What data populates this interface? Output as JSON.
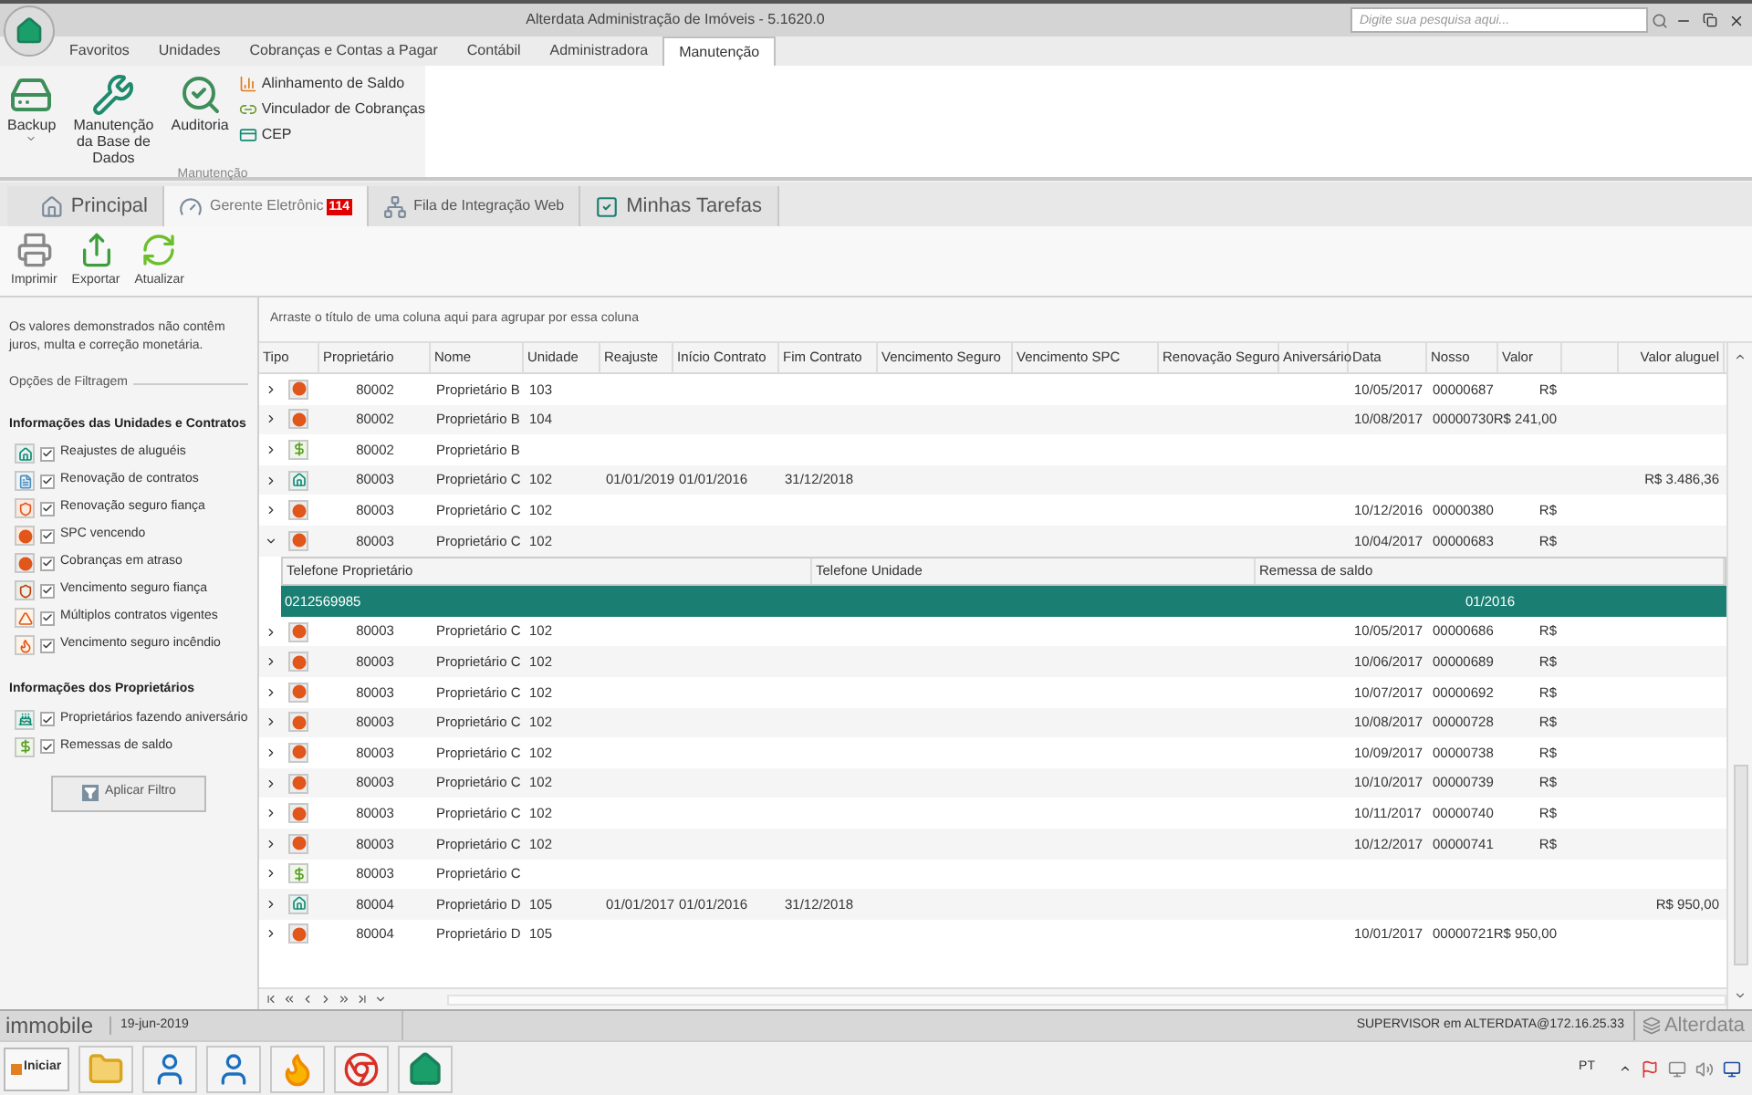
{
  "window": {
    "title": "Alterdata Administração de Imóveis - 5.1620.0",
    "search": {
      "placeholder": "Digite sua pesquisa aqui..."
    }
  },
  "ribbon": {
    "tabs": [
      {
        "label": "Favoritos",
        "selected": false
      },
      {
        "label": "Unidades",
        "selected": false
      },
      {
        "label": "Cobranças e Contas a Pagar",
        "selected": false
      },
      {
        "label": "Contábil",
        "selected": false
      },
      {
        "label": "Administradora",
        "selected": false
      },
      {
        "label": "Manutenção",
        "selected": true
      }
    ],
    "group": {
      "label": "Manutenção",
      "large_buttons": [
        {
          "kind": "backup",
          "label": "Backup",
          "dropdown": true
        },
        {
          "kind": "database",
          "label": "Manutenção da Base de Dados",
          "dropdown": false
        },
        {
          "kind": "audit",
          "label": "Auditoria",
          "dropdown": false
        }
      ],
      "small_buttons": [
        {
          "kind": "align",
          "label": "Alinhamento de Saldo"
        },
        {
          "kind": "link",
          "label": "Vinculador de Cobranças"
        },
        {
          "kind": "card",
          "label": "CEP"
        }
      ]
    }
  },
  "doc_tabs": [
    {
      "kind": "home",
      "label": "Principal",
      "selected": false
    },
    {
      "kind": "manager",
      "label": "Gerente Eletrônic",
      "selected": true,
      "badge": "114"
    },
    {
      "kind": "queue",
      "label": "Fila de Integração Web",
      "selected": false
    },
    {
      "kind": "tasks",
      "label": "Minhas Tarefas",
      "selected": false
    }
  ],
  "toolbar": [
    {
      "kind": "print",
      "label": "Imprimir"
    },
    {
      "kind": "export",
      "label": "Exportar"
    },
    {
      "kind": "refresh",
      "label": "Atualizar"
    }
  ],
  "filter_panel": {
    "note": "Os valores demonstrados não contêm juros, multa e correção monetária.",
    "options_label": "Opções de Filtragem",
    "sections": [
      {
        "title": "Informações das Unidades e Contratos",
        "items": [
          {
            "kind": "adjust",
            "label": "Reajustes de aluguéis",
            "checked": true
          },
          {
            "kind": "renewal",
            "label": "Renovação de contratos",
            "checked": true
          },
          {
            "kind": "insurance",
            "label": "Renovação seguro fiança",
            "checked": true
          },
          {
            "kind": "spc",
            "label": "SPC vencendo",
            "checked": true
          },
          {
            "kind": "charge",
            "label": "Cobranças em atraso",
            "checked": true
          },
          {
            "kind": "insurance_due",
            "label": "Vencimento seguro fiança",
            "checked": true
          },
          {
            "kind": "multiple",
            "label": "Múltiplos contratos vigentes",
            "checked": true
          },
          {
            "kind": "fire",
            "label": "Vencimento seguro incêndio",
            "checked": true
          }
        ]
      },
      {
        "title": "Informações dos Proprietários",
        "items": [
          {
            "kind": "birthday",
            "label": "Proprietários fazendo aniversário",
            "checked": true
          },
          {
            "kind": "balance",
            "label": "Remessas de saldo",
            "checked": true
          }
        ]
      }
    ],
    "apply_button": "Aplicar Filtro"
  },
  "grid": {
    "group_hint": "Arraste o título de uma coluna aqui para agrupar por essa coluna",
    "columns": [
      "Tipo",
      "Proprietário",
      "Nome",
      "Unidade",
      "Reajuste",
      "Início Contrato",
      "Fim Contrato",
      "Vencimento Seguro",
      "Vencimento SPC",
      "Renovação Seguro",
      "Aniversário",
      "Data",
      "Nosso",
      "Valor",
      "Valor aluguel"
    ],
    "rows": [
      {
        "kind": "charge",
        "expanded": false,
        "proprietario": "80002",
        "nome": "Proprietário B",
        "unidade": "103",
        "data": "10/05/2017",
        "nosso": "00000687",
        "valor": "R$"
      },
      {
        "kind": "charge",
        "expanded": false,
        "proprietario": "80002",
        "nome": "Proprietário B",
        "unidade": "104",
        "data": "10/08/2017",
        "nosso": "00000730",
        "valor": "R$ 241,00"
      },
      {
        "kind": "balance",
        "expanded": false,
        "proprietario": "80002",
        "nome": "Proprietário B"
      },
      {
        "kind": "adjust",
        "expanded": false,
        "proprietario": "80003",
        "nome": "Proprietário C",
        "unidade": "102",
        "reajuste": "01/01/2019",
        "inicio_contrato": "01/01/2016",
        "fim_contrato": "31/12/2018",
        "valor_aluguel": "R$ 3.486,36"
      },
      {
        "kind": "charge",
        "expanded": false,
        "proprietario": "80003",
        "nome": "Proprietário C",
        "unidade": "102",
        "data": "10/12/2016",
        "nosso": "00000380",
        "valor": "R$"
      },
      {
        "kind": "charge",
        "expanded": true,
        "proprietario": "80003",
        "nome": "Proprietário C",
        "unidade": "102",
        "data": "10/04/2017",
        "nosso": "00000683",
        "valor": "R$",
        "detail": {
          "columns": [
            "Telefone Proprietário",
            "Telefone Unidade",
            "Remessa de saldo"
          ],
          "rows": [
            {
              "selected": true,
              "telefone_proprietario": "0212569985",
              "remessa_de_saldo": "01/2016"
            }
          ]
        }
      },
      {
        "kind": "charge",
        "expanded": false,
        "proprietario": "80003",
        "nome": "Proprietário C",
        "unidade": "102",
        "data": "10/05/2017",
        "nosso": "00000686",
        "valor": "R$"
      },
      {
        "kind": "charge",
        "expanded": false,
        "proprietario": "80003",
        "nome": "Proprietário C",
        "unidade": "102",
        "data": "10/06/2017",
        "nosso": "00000689",
        "valor": "R$"
      },
      {
        "kind": "charge",
        "expanded": false,
        "proprietario": "80003",
        "nome": "Proprietário C",
        "unidade": "102",
        "data": "10/07/2017",
        "nosso": "00000692",
        "valor": "R$"
      },
      {
        "kind": "charge",
        "expanded": false,
        "proprietario": "80003",
        "nome": "Proprietário C",
        "unidade": "102",
        "data": "10/08/2017",
        "nosso": "00000728",
        "valor": "R$"
      },
      {
        "kind": "charge",
        "expanded": false,
        "proprietario": "80003",
        "nome": "Proprietário C",
        "unidade": "102",
        "data": "10/09/2017",
        "nosso": "00000738",
        "valor": "R$"
      },
      {
        "kind": "charge",
        "expanded": false,
        "proprietario": "80003",
        "nome": "Proprietário C",
        "unidade": "102",
        "data": "10/10/2017",
        "nosso": "00000739",
        "valor": "R$"
      },
      {
        "kind": "charge",
        "expanded": false,
        "proprietario": "80003",
        "nome": "Proprietário C",
        "unidade": "102",
        "data": "10/11/2017",
        "nosso": "00000740",
        "valor": "R$"
      },
      {
        "kind": "charge",
        "expanded": false,
        "proprietario": "80003",
        "nome": "Proprietário C",
        "unidade": "102",
        "data": "10/12/2017",
        "nosso": "00000741",
        "valor": "R$"
      },
      {
        "kind": "balance",
        "expanded": false,
        "proprietario": "80003",
        "nome": "Proprietário C"
      },
      {
        "kind": "adjust",
        "expanded": false,
        "proprietario": "80004",
        "nome": "Proprietário D",
        "unidade": "105",
        "reajuste": "01/01/2017",
        "inicio_contrato": "01/01/2016",
        "fim_contrato": "31/12/2018",
        "valor_aluguel": "R$ 950,00"
      },
      {
        "kind": "charge",
        "expanded": false,
        "proprietario": "80004",
        "nome": "Proprietário D",
        "unidade": "105",
        "data": "10/01/2017",
        "nosso": "00000721",
        "valor": "R$ 950,00"
      }
    ]
  },
  "status_bar": {
    "product": "immobile",
    "date": "19-jun-2019",
    "session": "SUPERVISOR em ALTERDATA@172.16.25.33",
    "brand": "Alterdata"
  },
  "taskbar": {
    "start": "Iniciar",
    "apps": [
      {
        "kind": "folder"
      },
      {
        "kind": "person"
      },
      {
        "kind": "person"
      },
      {
        "kind": "flame"
      },
      {
        "kind": "browser"
      },
      {
        "kind": "home"
      }
    ],
    "language": "PT"
  }
}
